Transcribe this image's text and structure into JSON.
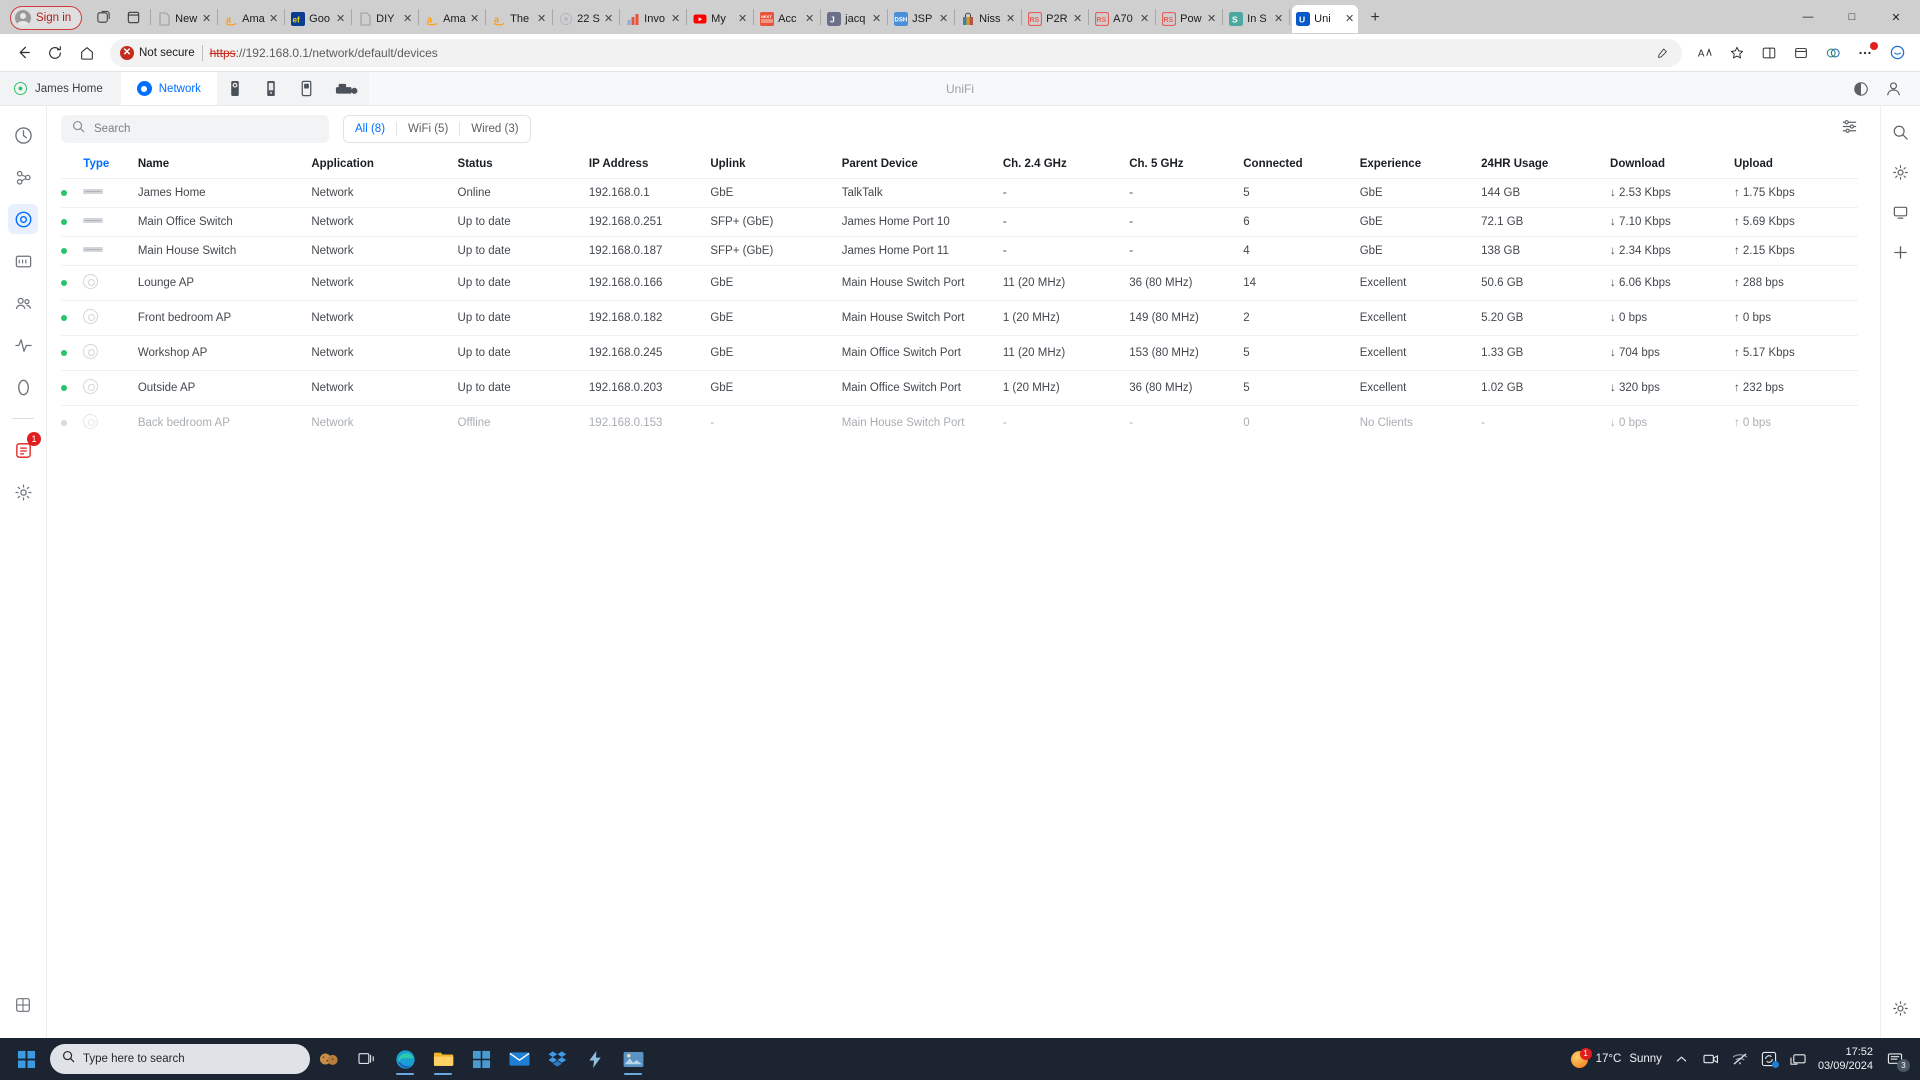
{
  "browser": {
    "signin_label": "Sign in",
    "tabs": [
      {
        "title": "New",
        "fav": "doc",
        "color": "#9aa0a6",
        "active": false
      },
      {
        "title": "Ama",
        "fav": "a",
        "color": "#ff9900",
        "active": false
      },
      {
        "title": "Goo",
        "fav": "ef",
        "color": "#0a3d91",
        "active": false
      },
      {
        "title": "DIY",
        "fav": "doc",
        "color": "#9aa0a6",
        "active": false
      },
      {
        "title": "Ama",
        "fav": "a",
        "color": "#ff9900",
        "active": false
      },
      {
        "title": "The",
        "fav": "a",
        "color": "#ff9900",
        "active": false
      },
      {
        "title": "22 S",
        "fav": "circle",
        "color": "#b5b9bd",
        "active": false
      },
      {
        "title": "Invo",
        "fav": "bars",
        "color": "#e8533b",
        "active": false
      },
      {
        "title": "My",
        "fav": "yt",
        "color": "#ff0000",
        "active": false
      },
      {
        "title": "Acc",
        "fav": "next",
        "color": "#e8533b",
        "active": false
      },
      {
        "title": "jacq",
        "fav": "J",
        "color": "#6b6f8a",
        "active": false
      },
      {
        "title": "JSP",
        "fav": "DSH",
        "color": "#4a90d9",
        "active": false
      },
      {
        "title": "Niss",
        "fav": "bag",
        "color": "#d4a017",
        "active": false
      },
      {
        "title": "P2R",
        "fav": "RS",
        "color": "#e8605a",
        "active": false
      },
      {
        "title": "A70",
        "fav": "RS",
        "color": "#e8605a",
        "active": false
      },
      {
        "title": "Pow",
        "fav": "RS",
        "color": "#e8605a",
        "active": false
      },
      {
        "title": "In S",
        "fav": "S",
        "color": "#4aa8a0",
        "active": false
      },
      {
        "title": "Uni",
        "fav": "U",
        "color": "#0559c9",
        "active": true
      }
    ],
    "new_tab_label": "+",
    "window_minimize": "—",
    "window_maximize": "□",
    "window_close": "✕",
    "address": {
      "security_label": "Not secure",
      "scheme": "https",
      "rest": "://192.168.0.1/network/default/devices",
      "host": "192.168.0.1",
      "path": "/network/default/devices"
    }
  },
  "unifi": {
    "site_name": "James Home",
    "brand": "UniFi",
    "app_tab_label": "Network",
    "search_placeholder": "Search",
    "filters": [
      {
        "label": "All (8)",
        "active": true
      },
      {
        "label": "WiFi (5)",
        "active": false
      },
      {
        "label": "Wired (3)",
        "active": false
      }
    ],
    "columns": [
      {
        "key": "type",
        "label": "Type",
        "sorted": true
      },
      {
        "key": "name",
        "label": "Name",
        "sorted": false
      },
      {
        "key": "app",
        "label": "Application",
        "sorted": false
      },
      {
        "key": "status",
        "label": "Status",
        "sorted": false
      },
      {
        "key": "ip",
        "label": "IP Address",
        "sorted": false
      },
      {
        "key": "uplink",
        "label": "Uplink",
        "sorted": false
      },
      {
        "key": "parent",
        "label": "Parent Device",
        "sorted": false
      },
      {
        "key": "ch24",
        "label": "Ch. 2.4 GHz",
        "sorted": false
      },
      {
        "key": "ch5",
        "label": "Ch. 5 GHz",
        "sorted": false
      },
      {
        "key": "conn",
        "label": "Connected",
        "sorted": false
      },
      {
        "key": "exp",
        "label": "Experience",
        "sorted": false
      },
      {
        "key": "usage",
        "label": "24HR Usage",
        "sorted": false
      },
      {
        "key": "down",
        "label": "Download",
        "sorted": false
      },
      {
        "key": "up",
        "label": "Upload",
        "sorted": false
      }
    ],
    "rows": [
      {
        "online": true,
        "icon": "switch",
        "offline": false,
        "name": "James Home",
        "app": "Network",
        "status": "Online",
        "ip": "192.168.0.1",
        "uplink": "GbE",
        "parent": "TalkTalk",
        "ch24": "-",
        "ch5": "-",
        "connected": "5",
        "experience": "GbE",
        "exp_style": "good",
        "usage": "144 GB",
        "download": "↓ 2.53 Kbps",
        "dl_style": "dl",
        "upload": "↑ 1.75 Kbps",
        "ul_style": "ul"
      },
      {
        "online": true,
        "icon": "switch",
        "offline": false,
        "name": "Main Office Switch",
        "app": "Network",
        "status": "Up to date",
        "ip": "192.168.0.251",
        "uplink": "SFP+ (GbE)",
        "parent": "James Home Port 10",
        "ch24": "-",
        "ch5": "-",
        "connected": "6",
        "experience": "GbE",
        "exp_style": "good",
        "usage": "72.1 GB",
        "download": "↓ 7.10 Kbps",
        "dl_style": "dl",
        "upload": "↑ 5.69 Kbps",
        "ul_style": "ul"
      },
      {
        "online": true,
        "icon": "switch",
        "offline": false,
        "name": "Main House Switch",
        "app": "Network",
        "status": "Up to date",
        "ip": "192.168.0.187",
        "uplink": "SFP+ (GbE)",
        "parent": "James Home Port 11",
        "ch24": "-",
        "ch5": "-",
        "connected": "4",
        "experience": "GbE",
        "exp_style": "good",
        "usage": "138 GB",
        "download": "↓ 2.34 Kbps",
        "dl_style": "dl",
        "upload": "↑ 2.15 Kbps",
        "ul_style": "ul"
      },
      {
        "online": true,
        "icon": "ap",
        "offline": false,
        "name": "Lounge AP",
        "app": "Network",
        "status": "Up to date",
        "ip": "192.168.0.166",
        "uplink": "GbE",
        "parent": "Main House Switch Port",
        "ch24": "11 (20 MHz)",
        "ch5": "36 (80 MHz)",
        "connected": "14",
        "experience": "Excellent",
        "exp_style": "good",
        "usage": "50.6 GB",
        "download": "↓ 6.06 Kbps",
        "dl_style": "dl",
        "upload": "↑ 288 bps",
        "ul_style": "ul"
      },
      {
        "online": true,
        "icon": "ap",
        "offline": false,
        "name": "Front bedroom AP",
        "app": "Network",
        "status": "Up to date",
        "ip": "192.168.0.182",
        "uplink": "GbE",
        "parent": "Main House Switch Port",
        "ch24": "1 (20 MHz)",
        "ch5": "149 (80 MHz)",
        "connected": "2",
        "experience": "Excellent",
        "exp_style": "good",
        "usage": "5.20 GB",
        "download": "↓ 0 bps",
        "dl_style": "zero",
        "upload": "↑ 0 bps",
        "ul_style": "zero"
      },
      {
        "online": true,
        "icon": "ap",
        "offline": false,
        "name": "Workshop AP",
        "app": "Network",
        "status": "Up to date",
        "ip": "192.168.0.245",
        "uplink": "GbE",
        "parent": "Main Office Switch Port",
        "ch24": "11 (20 MHz)",
        "ch5": "153 (80 MHz)",
        "connected": "5",
        "experience": "Excellent",
        "exp_style": "good",
        "usage": "1.33 GB",
        "download": "↓ 704 bps",
        "dl_style": "dl",
        "upload": "↑ 5.17 Kbps",
        "ul_style": "ul"
      },
      {
        "online": true,
        "icon": "ap",
        "offline": false,
        "name": "Outside AP",
        "app": "Network",
        "status": "Up to date",
        "ip": "192.168.0.203",
        "uplink": "GbE",
        "parent": "Main Office Switch Port",
        "ch24": "1 (20 MHz)",
        "ch5": "36 (80 MHz)",
        "connected": "5",
        "experience": "Excellent",
        "exp_style": "good",
        "usage": "1.02 GB",
        "download": "↓ 320 bps",
        "dl_style": "dl",
        "upload": "↑ 232 bps",
        "ul_style": "ul"
      },
      {
        "online": false,
        "icon": "ap",
        "offline": true,
        "name": "Back bedroom AP",
        "app": "Network",
        "status": "Offline",
        "ip": "192.168.0.153",
        "uplink": "-",
        "parent": "Main House Switch Port",
        "ch24": "-",
        "ch5": "-",
        "connected": "0",
        "experience": "No Clients",
        "exp_style": "none",
        "usage": "-",
        "download": "↓ 0 bps",
        "dl_style": "zero",
        "upload": "↑ 0 bps",
        "ul_style": "zero"
      }
    ],
    "rail_badge": "1"
  },
  "taskbar": {
    "search_placeholder": "Type here to search",
    "temperature": "17°C",
    "weather": "Sunny",
    "weather_badge": "1",
    "time": "17:52",
    "date": "03/09/2024",
    "notification_count": "3"
  }
}
